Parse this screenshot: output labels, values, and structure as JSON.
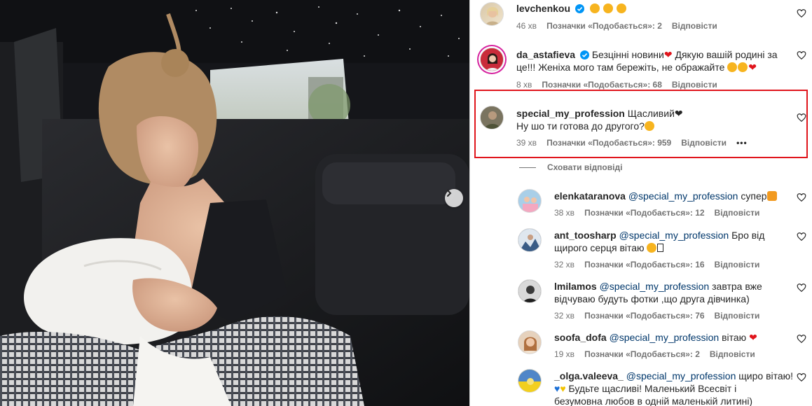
{
  "comments": [
    {
      "username": "levchenkou",
      "text": "",
      "emojis": [
        "star-eyes",
        "star-eyes",
        "star-eyes"
      ],
      "time": "46 хв",
      "likes": "Позначки «Подобається»: 2",
      "reply": "Відповісти",
      "verified": true
    },
    {
      "username": "da_astafieva",
      "line1": "Безцінні новини",
      "line1b": " Дякую вашій родині за",
      "line2": "це!!! Женіха мого там бережіть, не ображайте",
      "time": "8 хв",
      "likes": "Позначки «Подобається»: 68",
      "reply": "Відповісти",
      "verified": true
    },
    {
      "username": "special_my_profession",
      "line1": "Щасливий",
      "line2": "Ну шо ти готова до другого?",
      "time": "39 хв",
      "likes": "Позначки «Подобається»: 959",
      "reply": "Відповісти",
      "more": "•••"
    }
  ],
  "hide_replies": "Сховати відповіді",
  "replies": [
    {
      "username": "elenkataranova",
      "mention": "@special_my_profession",
      "line1": " супер",
      "time": "38 хв",
      "likes": "Позначки «Подобається»: 12",
      "reply": "Відповісти"
    },
    {
      "username": "ant_toosharp",
      "mention": "@special_my_profession",
      "line1": " Бро від",
      "line2": "щирого серця вітаю",
      "time": "32 хв",
      "likes": "Позначки «Подобається»: 16",
      "reply": "Відповісти"
    },
    {
      "username": "lmilamos",
      "mention": "@special_my_profession",
      "line1": " завтра вже",
      "line2": "відчуваю будуть фотки ,що друга дівчинка)",
      "time": "32 хв",
      "likes": "Позначки «Подобається»: 76",
      "reply": "Відповісти"
    },
    {
      "username": "soofa_dofa",
      "mention": "@special_my_profession",
      "line1": " вітаю",
      "time": "19 хв",
      "likes": "Позначки «Подобається»: 2",
      "reply": "Відповісти"
    },
    {
      "username": "_olga.valeeva_",
      "mention": "@special_my_profession",
      "line1": " щиро вітаю!",
      "line2": " Будьте щасливі! Маленький Всесвіт і",
      "line3": "безумовна любов в одній маленькій литині)"
    }
  ],
  "colors": {
    "highlight": "#e0151c",
    "mention": "#00376b",
    "meta": "#737373",
    "verified": "#0095f6"
  },
  "icons": [
    "heart-outline-icon",
    "verified-badge-icon",
    "chevron-right-icon"
  ]
}
